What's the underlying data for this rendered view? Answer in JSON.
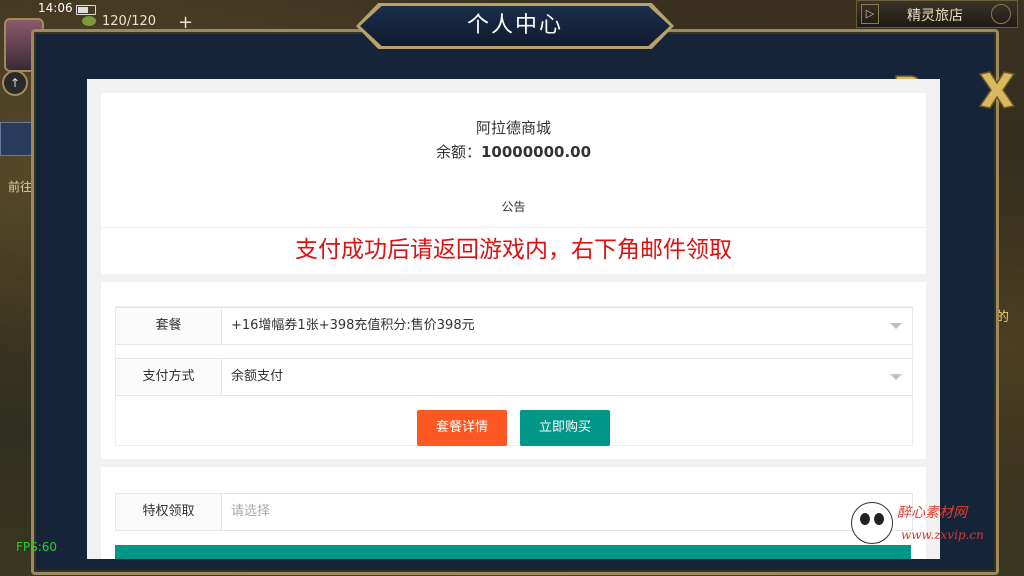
{
  "status": {
    "time": "14:06",
    "energy": "120/120"
  },
  "hud": {
    "plus": "+",
    "left_label": "前往",
    "shop_label": "精灵旅店",
    "right_edge_text": "的",
    "fps": "FPS:60",
    "shop_arrow": "▷"
  },
  "panel": {
    "title": "个人中心"
  },
  "web": {
    "shop_name": "阿拉德商城",
    "balance_label": "余额：",
    "balance_value": "10000000.00",
    "notice_title": "公告",
    "notice_text": "支付成功后请返回游戏内，右下角邮件领取",
    "package_label": "套餐",
    "package_value": "+16增幅券1张+398充值积分:售价398元",
    "payment_label": "支付方式",
    "payment_value": "余额支付",
    "detail_button": "套餐详情",
    "buy_button": "立即购买",
    "privilege_label": "特权领取",
    "privilege_placeholder": "请选择"
  },
  "watermark": {
    "text": "醉心素材网",
    "url": "www.zxvip.cn"
  },
  "colors": {
    "notice": "#e01010",
    "detail_btn": "#ff5722",
    "buy_btn": "#009688",
    "frame_gold": "#b8a26a",
    "panel_bg": "#16243a"
  }
}
